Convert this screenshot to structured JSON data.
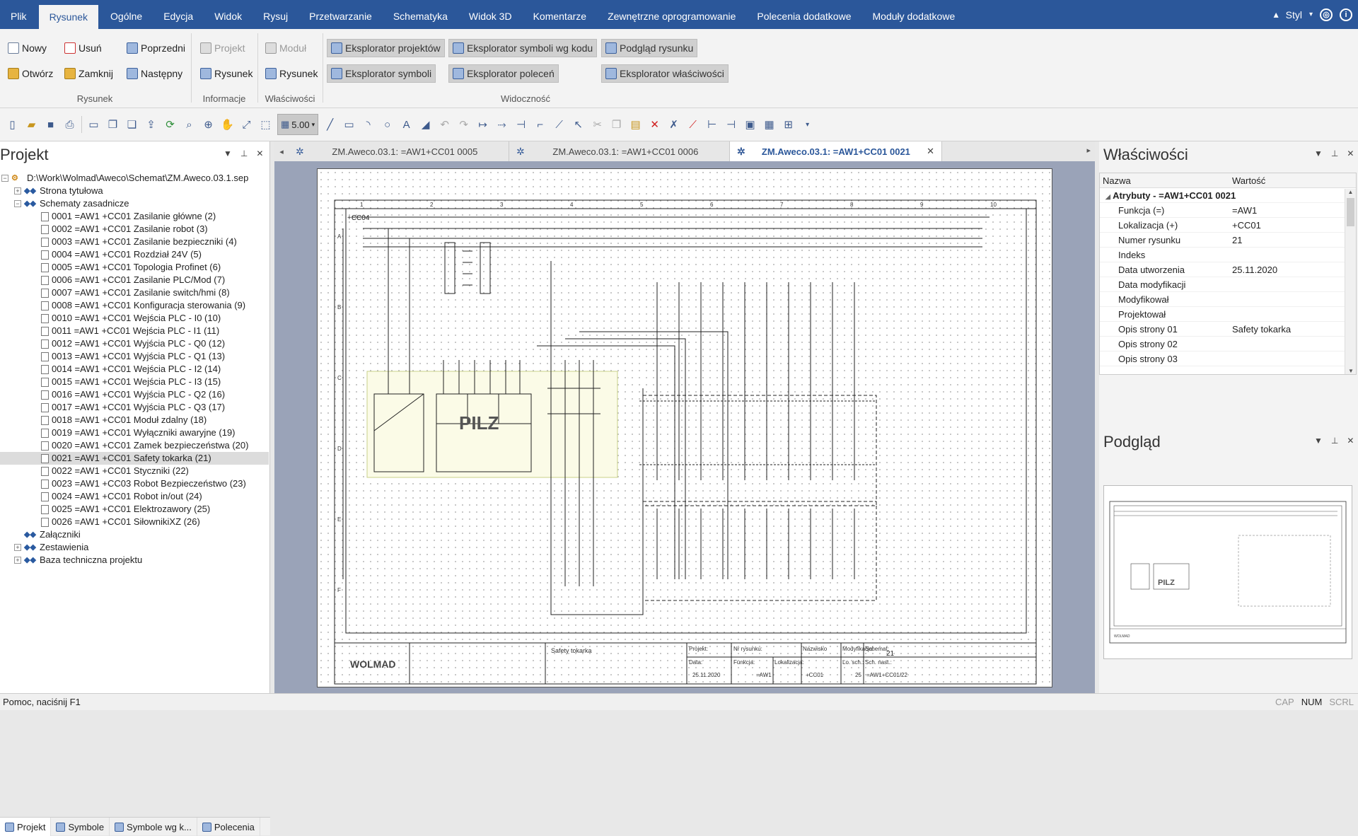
{
  "menu": {
    "items": [
      "Plik",
      "Rysunek",
      "Ogólne",
      "Edycja",
      "Widok",
      "Rysuj",
      "Przetwarzanie",
      "Schematyka",
      "Widok 3D",
      "Komentarze",
      "Zewnętrzne oprogramowanie",
      "Polecenia dodatkowe",
      "Moduły dodatkowe"
    ],
    "active": "Rysunek",
    "style_label": "Styl"
  },
  "ribbon": {
    "rysunek": {
      "nowy": "Nowy",
      "usun": "Usuń",
      "poprzedni": "Poprzedni",
      "otworz": "Otwórz",
      "zamknij": "Zamknij",
      "nastepny": "Następny",
      "label": "Rysunek"
    },
    "informacje": {
      "projekt": "Projekt",
      "rysunek": "Rysunek",
      "label": "Informacje"
    },
    "wlasciwosci": {
      "modul": "Moduł",
      "rysunek": "Rysunek",
      "label": "Właściwości"
    },
    "widocznosc": {
      "eksplorator_projektow": "Eksplorator projektów",
      "eksplorator_symboli_kod": "Eksplorator symboli wg kodu",
      "podglad_rysunku": "Podgląd rysunku",
      "eksplorator_symboli": "Eksplorator symboli",
      "eksplorator_polecen": "Eksplorator poleceń",
      "eksplorator_wlasciwosci": "Eksplorator właściwości",
      "label": "Widoczność"
    }
  },
  "toolbar": {
    "zoom_value": "5.00"
  },
  "project_panel": {
    "title": "Projekt",
    "root": "D:\\Work\\Wolmad\\Aweco\\Schemat\\ZM.Aweco.03.1.sep",
    "nodes": [
      {
        "label": "Strona tytułowa",
        "level": 1,
        "type": "folder",
        "exp": "+"
      },
      {
        "label": "Schematy zasadnicze",
        "level": 1,
        "type": "folder",
        "exp": "−"
      },
      {
        "label": "0001 =AW1 +CC01 Zasilanie główne (2)",
        "level": 2,
        "type": "page"
      },
      {
        "label": "0002 =AW1 +CC01 Zasilanie robot (3)",
        "level": 2,
        "type": "page"
      },
      {
        "label": "0003 =AW1 +CC01 Zasilanie bezpieczniki (4)",
        "level": 2,
        "type": "page"
      },
      {
        "label": "0004 =AW1 +CC01 Rozdział 24V (5)",
        "level": 2,
        "type": "page"
      },
      {
        "label": "0005 =AW1 +CC01 Topologia Profinet (6)",
        "level": 2,
        "type": "page"
      },
      {
        "label": "0006 =AW1 +CC01 Zasilanie PLC/Mod (7)",
        "level": 2,
        "type": "page"
      },
      {
        "label": "0007 =AW1 +CC01 Zasilanie switch/hmi (8)",
        "level": 2,
        "type": "page"
      },
      {
        "label": "0008 =AW1 +CC01 Konfiguracja sterowania (9)",
        "level": 2,
        "type": "page"
      },
      {
        "label": "0010 =AW1 +CC01 Wejścia PLC - I0 (10)",
        "level": 2,
        "type": "page"
      },
      {
        "label": "0011 =AW1 +CC01 Wejścia PLC - I1 (11)",
        "level": 2,
        "type": "page"
      },
      {
        "label": "0012 =AW1 +CC01 Wyjścia PLC - Q0 (12)",
        "level": 2,
        "type": "page"
      },
      {
        "label": "0013 =AW1 +CC01 Wyjścia PLC - Q1 (13)",
        "level": 2,
        "type": "page"
      },
      {
        "label": "0014 =AW1 +CC01 Wejścia PLC - I2 (14)",
        "level": 2,
        "type": "page"
      },
      {
        "label": "0015 =AW1 +CC01 Wejścia PLC - I3 (15)",
        "level": 2,
        "type": "page"
      },
      {
        "label": "0016 =AW1 +CC01 Wyjścia PLC - Q2 (16)",
        "level": 2,
        "type": "page"
      },
      {
        "label": "0017 =AW1 +CC01 Wyjścia PLC - Q3 (17)",
        "level": 2,
        "type": "page"
      },
      {
        "label": "0018 =AW1 +CC01 Moduł zdalny (18)",
        "level": 2,
        "type": "page"
      },
      {
        "label": "0019 =AW1 +CC01 Wyłączniki awaryjne (19)",
        "level": 2,
        "type": "page"
      },
      {
        "label": "0020 =AW1 +CC01 Zamek bezpieczeństwa (20)",
        "level": 2,
        "type": "page"
      },
      {
        "label": "0021 =AW1 +CC01 Safety tokarka (21)",
        "level": 2,
        "type": "page",
        "selected": true
      },
      {
        "label": "0022 =AW1 +CC01 Styczniki (22)",
        "level": 2,
        "type": "page"
      },
      {
        "label": "0023 =AW1 +CC03 Robot Bezpieczeństwo (23)",
        "level": 2,
        "type": "page"
      },
      {
        "label": "0024 =AW1 +CC01 Robot in/out (24)",
        "level": 2,
        "type": "page"
      },
      {
        "label": "0025 =AW1 +CC01 Elektrozawory (25)",
        "level": 2,
        "type": "page"
      },
      {
        "label": "0026 =AW1 +CC01 SiłownikiXZ (26)",
        "level": 2,
        "type": "page"
      },
      {
        "label": "Załączniki",
        "level": 1,
        "type": "folder",
        "exp": ""
      },
      {
        "label": "Zestawienia",
        "level": 1,
        "type": "folder",
        "exp": "+"
      },
      {
        "label": "Baza techniczna projektu",
        "level": 1,
        "type": "folder",
        "exp": "+"
      }
    ],
    "tabs": [
      "Projekt",
      "Symbole",
      "Symbole wg k...",
      "Polecenia"
    ]
  },
  "doc_tabs": [
    {
      "label": "ZM.Aweco.03.1: =AW1+CC01 0005",
      "active": false
    },
    {
      "label": "ZM.Aweco.03.1: =AW1+CC01 0006",
      "active": false
    },
    {
      "label": "ZM.Aweco.03.1: =AW1+CC01 0021",
      "active": true
    }
  ],
  "drawing": {
    "brand": "PILZ",
    "company": "WOLMAD",
    "title_text": "Safety tokarka",
    "tb_projekt": "Projekt:",
    "tb_nr": "Nr rysunku:",
    "tb_nazwisko": "Nazwisko",
    "tb_modyfikacja": "Modyfikacja:",
    "tb_schemat": "Schemat:",
    "tb_schemat_val": "21",
    "tb_data": "Data:",
    "tb_data_val": "25.11.2020",
    "tb_funkcja": "Funkcja:",
    "tb_funkcja_val": "=AW1",
    "tb_lokalizacja": "Lokalizacja:",
    "tb_lokalizacja_val": "+CC01",
    "tb_lsch": "Lo. sch.:",
    "tb_lsch_val": "25",
    "tb_schnast": "Sch. nast.:",
    "tb_schnast_val": "=AW1+CC01/22",
    "cc04": "+CC04",
    "cols": [
      "1",
      "2",
      "3",
      "4",
      "5",
      "6",
      "7",
      "8",
      "9",
      "10"
    ],
    "rows": [
      "A",
      "B",
      "C",
      "D",
      "E",
      "F"
    ]
  },
  "properties": {
    "title": "Właściwości",
    "col_name": "Nazwa",
    "col_value": "Wartość",
    "group": "Atrybuty - =AW1+CC01 0021",
    "rows": [
      {
        "name": "Funkcja (=)",
        "value": "=AW1"
      },
      {
        "name": "Lokalizacja (+)",
        "value": "+CC01"
      },
      {
        "name": "Numer rysunku",
        "value": "21"
      },
      {
        "name": "Indeks",
        "value": ""
      },
      {
        "name": "Data utworzenia",
        "value": "25.11.2020"
      },
      {
        "name": "Data modyfikacji",
        "value": ""
      },
      {
        "name": "Modyfikował",
        "value": ""
      },
      {
        "name": "Projektował",
        "value": ""
      },
      {
        "name": "Opis strony 01",
        "value": "Safety tokarka"
      },
      {
        "name": "Opis strony 02",
        "value": ""
      },
      {
        "name": "Opis strony 03",
        "value": ""
      }
    ]
  },
  "preview": {
    "title": "Podgląd"
  },
  "status": {
    "help": "Pomoc, naciśnij F1",
    "cap": "CAP",
    "num": "NUM",
    "scrl": "SCRL"
  }
}
